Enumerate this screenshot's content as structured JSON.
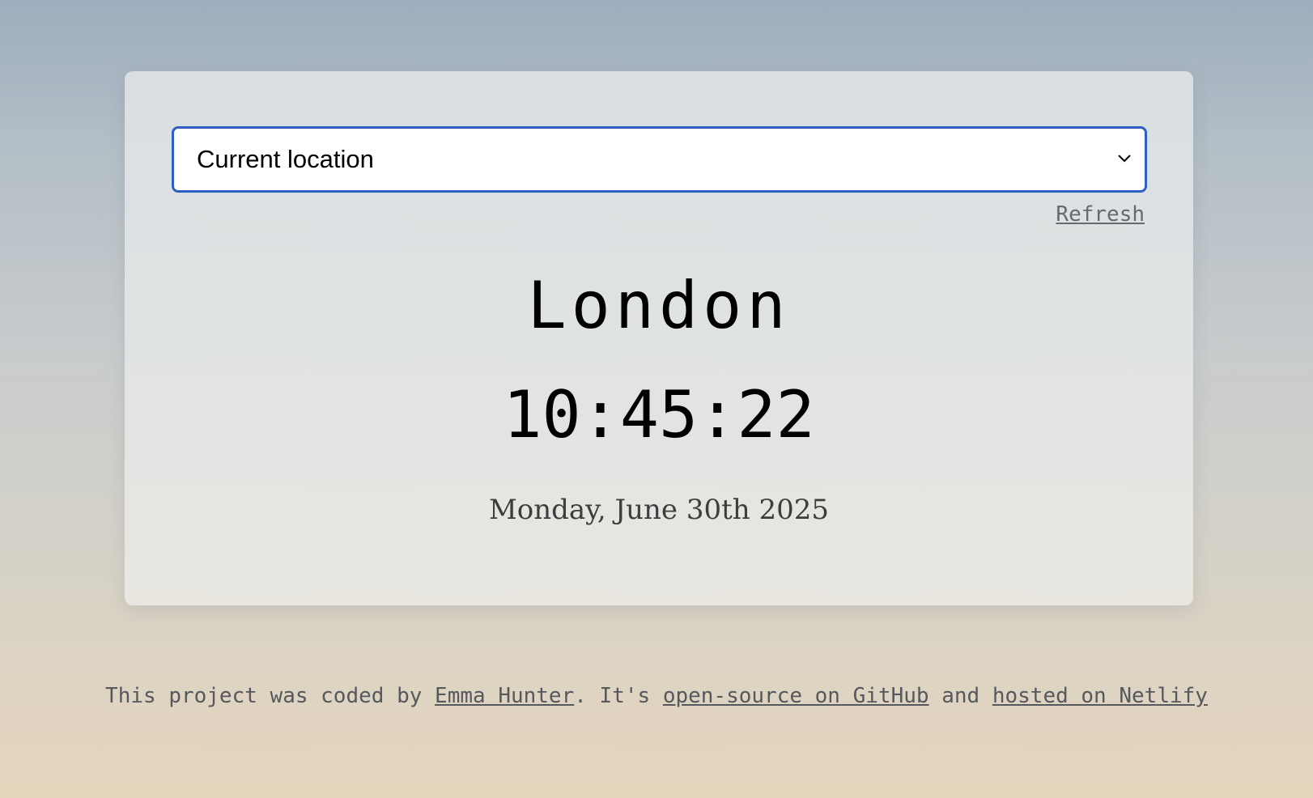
{
  "location_select": {
    "selected": "Current location",
    "icon": "chevron-down-icon"
  },
  "refresh_label": "Refresh",
  "clock": {
    "city": "London",
    "time": "10:45:22",
    "date": "Monday, June 30th 2025"
  },
  "footer": {
    "text_before": "This project was coded by ",
    "author_link": "Emma Hunter",
    "text_middle": ". It's ",
    "github_link": "open-source on GitHub",
    "text_and": " and ",
    "netlify_link": "hosted on Netlify"
  },
  "colors": {
    "select_border": "#2f5fc0",
    "text": "#000000",
    "muted_text": "#55595d"
  }
}
